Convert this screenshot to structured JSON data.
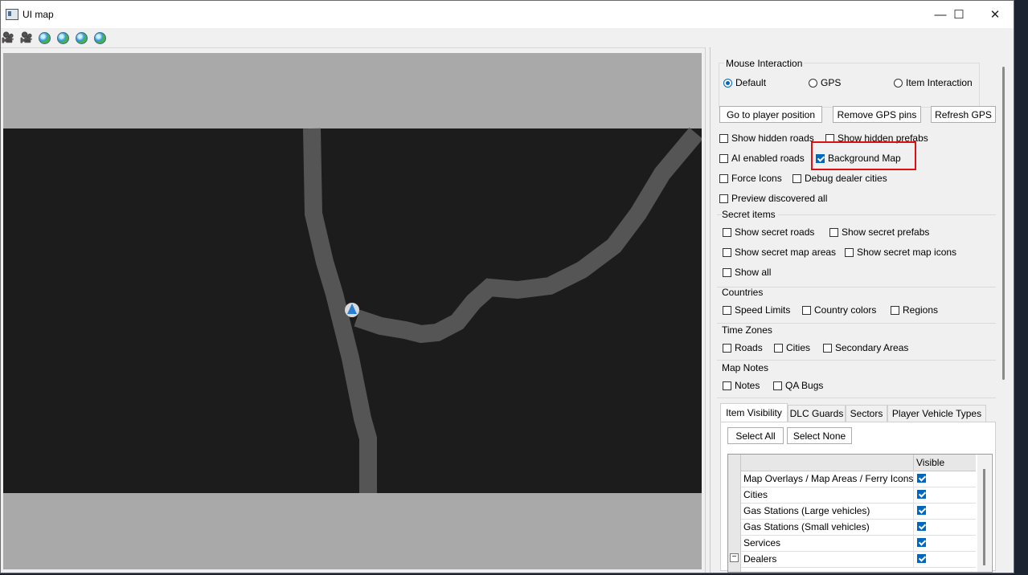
{
  "window": {
    "title": "UI map",
    "minimize": "—",
    "maximize": "☐",
    "close": "✕"
  },
  "toolbar": {
    "icons": [
      "camera-icon",
      "camera-icon",
      "globe-icon",
      "globe-icon",
      "globe-icon",
      "globe-icon"
    ]
  },
  "mouse_interaction": {
    "label": "Mouse Interaction",
    "options": [
      "Default",
      "GPS",
      "Item Interaction"
    ],
    "selected": "Default"
  },
  "buttons": {
    "go_player": "Go to player position",
    "remove_gps": "Remove GPS pins",
    "refresh_gps": "Refresh GPS"
  },
  "options": {
    "show_hidden_roads": "Show hidden roads",
    "show_hidden_prefabs": "Show hidden prefabs",
    "ai_enabled_roads": "AI enabled roads",
    "background_map": "Background Map",
    "force_icons": "Force Icons",
    "debug_dealer_cities": "Debug dealer cities",
    "preview_discovered_all": "Preview discovered all"
  },
  "secret_items": {
    "label": "Secret items",
    "show_secret_roads": "Show secret roads",
    "show_secret_prefabs": "Show secret prefabs",
    "show_secret_map_areas": "Show secret map areas",
    "show_secret_map_icons": "Show secret map icons",
    "show_all": "Show all"
  },
  "countries": {
    "label": "Countries",
    "speed_limits": "Speed Limits",
    "country_colors": "Country colors",
    "regions": "Regions"
  },
  "time_zones": {
    "label": "Time Zones",
    "roads": "Roads",
    "cities": "Cities",
    "secondary_areas": "Secondary Areas"
  },
  "map_notes": {
    "label": "Map Notes",
    "notes": "Notes",
    "qa_bugs": "QA Bugs"
  },
  "tabs": [
    "Item Visibility",
    "DLC Guards",
    "Sectors",
    "Player Vehicle Types"
  ],
  "selection": {
    "select_all": "Select All",
    "select_none": "Select None"
  },
  "grid": {
    "column": "Visible",
    "rows": [
      {
        "name": "Map Overlays / Map Areas / Ferry Icons",
        "visible": true
      },
      {
        "name": "Cities",
        "visible": true
      },
      {
        "name": "Gas Stations (Large vehicles)",
        "visible": true
      },
      {
        "name": "Gas Stations (Small vehicles)",
        "visible": true
      },
      {
        "name": "Services",
        "visible": true
      },
      {
        "name": "Dealers",
        "visible": true
      }
    ],
    "expander": "−"
  },
  "colors": {
    "accent": "#0067c0",
    "highlight": "#e01010",
    "map_bg": "#1c1c1c",
    "map_outside": "#a9a9a9",
    "road": "#555555"
  }
}
